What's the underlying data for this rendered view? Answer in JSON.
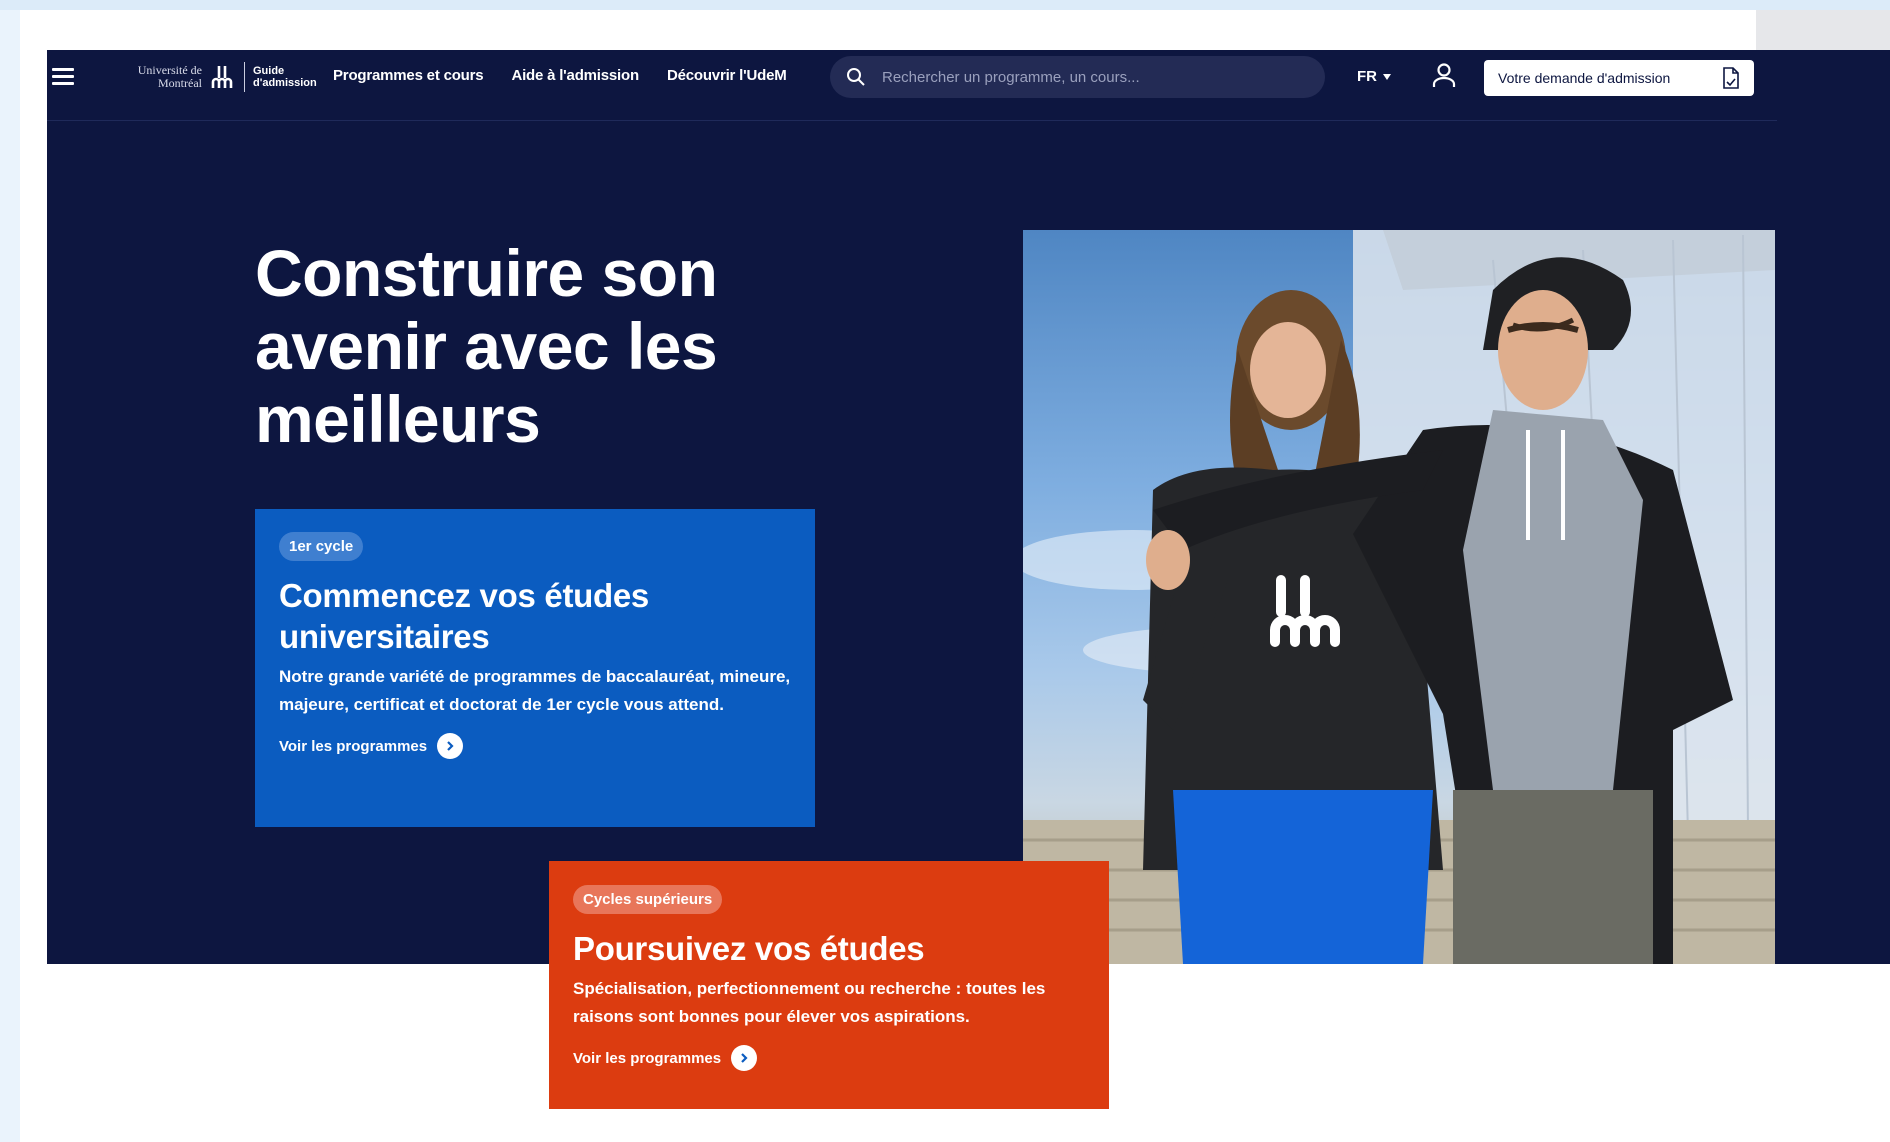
{
  "nav": {
    "logo_university": "Université de Montréal",
    "logo_guide": "Guide d'admission",
    "links": [
      "Programmes et cours",
      "Aide à l'admission",
      "Découvrir l'UdeM"
    ],
    "search_placeholder": "Rechercher un programme, un cours...",
    "language": "FR",
    "apply_label": "Votre demande d'admission"
  },
  "hero": {
    "title": "Construire son avenir avec les meilleurs"
  },
  "cards": {
    "undergrad": {
      "chip": "1er cycle",
      "title": "Commencez vos études universitaires",
      "text": "Notre grande variété de programmes de baccalauréat, mineure, majeure, certificat et doctorat de 1er cycle vous attend.",
      "link": "Voir les programmes"
    },
    "graduate": {
      "chip": "Cycles supérieurs",
      "title": "Poursuivez vos études",
      "text": "Spécialisation, perfectionnement ou recherche : toutes les raisons sont bonnes pour élever vos aspirations.",
      "link": "Voir les programmes"
    }
  },
  "colors": {
    "navy": "#0d1640",
    "blue_card": "#0b5cc0",
    "red_card": "#dc3c10"
  }
}
